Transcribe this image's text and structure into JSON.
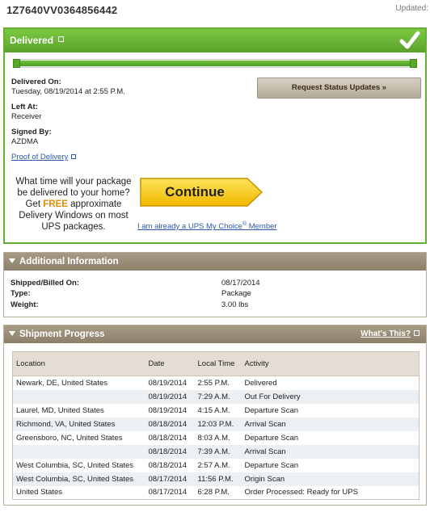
{
  "header": {
    "tracking_number": "1Z7640VV0364856442",
    "updated_label": "Updated:"
  },
  "status_panel": {
    "title": "Delivered",
    "progress": 1.0,
    "delivered_on_label": "Delivered On:",
    "delivered_on_value": "Tuesday,  08/19/2014 at 2:55 P.M.",
    "left_at_label": "Left At:",
    "left_at_value": "Receiver",
    "signed_by_label": "Signed By:",
    "signed_by_value": "AZDMA",
    "proof_link": "Proof of Delivery",
    "request_button": "Request Status Updates »",
    "promo": {
      "line1": "What time will your package",
      "line2": "be delivered to your home?",
      "get": "Get",
      "free": "FREE",
      "approx": "approximate",
      "line4": "Delivery Windows on most",
      "line5": "UPS packages."
    },
    "continue_button": "Continue",
    "mychoice_link": "I am already a UPS My Choice",
    "mychoice_reg": "®",
    "mychoice_member": " Member"
  },
  "additional_info": {
    "title": "Additional Information",
    "rows": [
      {
        "label": "Shipped/Billed On:",
        "value": "08/17/2014"
      },
      {
        "label": "Type:",
        "value": "Package"
      },
      {
        "label": "Weight:",
        "value": "3.00 lbs"
      }
    ]
  },
  "shipment_progress": {
    "title": "Shipment Progress",
    "whats_this": "What's This?",
    "columns": [
      "Location",
      "Date",
      "Local Time",
      "Activity"
    ],
    "rows": [
      {
        "location": "Newark, DE, United States",
        "date": "08/19/2014",
        "time": "2:55 P.M.",
        "activity": "Delivered"
      },
      {
        "location": "",
        "date": "08/19/2014",
        "time": "7:29 A.M.",
        "activity": "Out For Delivery"
      },
      {
        "location": "Laurel, MD, United States",
        "date": "08/19/2014",
        "time": "4:15 A.M.",
        "activity": "Departure Scan"
      },
      {
        "location": "Richmond, VA, United States",
        "date": "08/18/2014",
        "time": "12:03 P.M.",
        "activity": "Arrival Scan"
      },
      {
        "location": "Greensboro, NC, United States",
        "date": "08/18/2014",
        "time": "8:03 A.M.",
        "activity": "Departure Scan"
      },
      {
        "location": "",
        "date": "08/18/2014",
        "time": "7:39 A.M.",
        "activity": "Arrival Scan"
      },
      {
        "location": "West Columbia, SC, United States",
        "date": "08/18/2014",
        "time": "2:57 A.M.",
        "activity": "Departure Scan"
      },
      {
        "location": "West Columbia, SC, United States",
        "date": "08/17/2014",
        "time": "11:56 P.M.",
        "activity": "Origin Scan"
      },
      {
        "location": "United States",
        "date": "08/17/2014",
        "time": "6:28 P.M.",
        "activity": "Order Processed: Ready for UPS"
      }
    ]
  },
  "colors": {
    "delivered_green": "#64b032",
    "panel_tan": "#8c806b",
    "continue_yellow": "#f5c400",
    "free_orange": "#e48b00",
    "link_blue": "#2a5aa6"
  }
}
